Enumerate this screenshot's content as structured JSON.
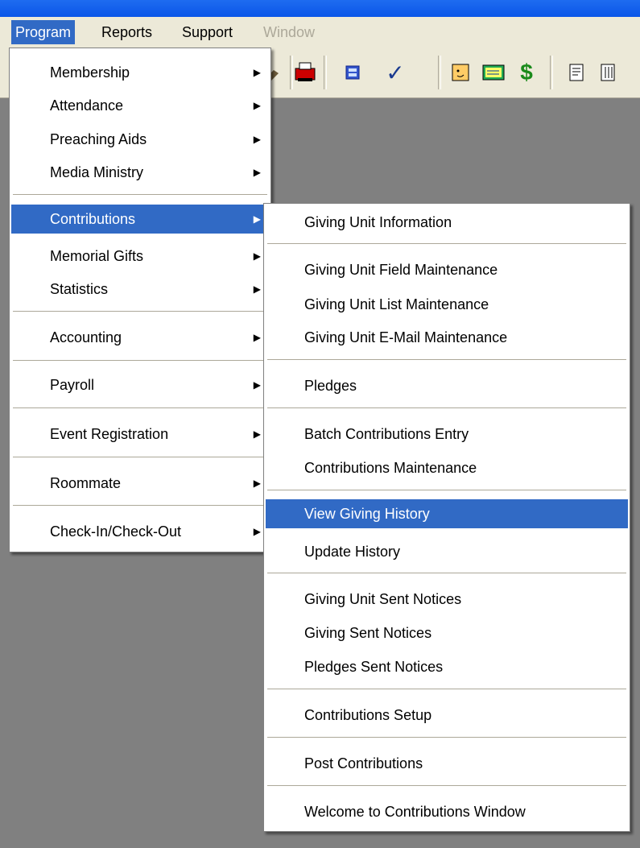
{
  "menubar": {
    "items": [
      {
        "label": "Program",
        "state": "active"
      },
      {
        "label": "Reports",
        "state": "normal"
      },
      {
        "label": "Support",
        "state": "normal"
      },
      {
        "label": "Window",
        "state": "disabled"
      }
    ]
  },
  "program_menu": {
    "items": [
      {
        "label": "Membership",
        "submenu": true
      },
      {
        "label": "Attendance",
        "submenu": true
      },
      {
        "label": "Preaching Aids",
        "submenu": true
      },
      {
        "label": "Media Ministry",
        "submenu": true
      },
      {
        "label": "Contributions",
        "submenu": true,
        "highlighted": true
      },
      {
        "label": "Memorial Gifts",
        "submenu": true
      },
      {
        "label": "Statistics",
        "submenu": true
      },
      {
        "label": "Accounting",
        "submenu": true
      },
      {
        "label": "Payroll",
        "submenu": true
      },
      {
        "label": "Event Registration",
        "submenu": true
      },
      {
        "label": "Roommate",
        "submenu": true
      },
      {
        "label": "Check-In/Check-Out",
        "submenu": true
      }
    ]
  },
  "contributions_menu": {
    "items": [
      {
        "label": "Giving Unit Information"
      },
      {
        "label": "Giving Unit Field Maintenance"
      },
      {
        "label": "Giving Unit List Maintenance"
      },
      {
        "label": "Giving Unit E-Mail Maintenance"
      },
      {
        "label": "Pledges"
      },
      {
        "label": "Batch Contributions Entry"
      },
      {
        "label": "Contributions Maintenance"
      },
      {
        "label": "View Giving History",
        "highlighted": true
      },
      {
        "label": "Update History"
      },
      {
        "label": "Giving Unit Sent Notices"
      },
      {
        "label": "Giving Sent Notices"
      },
      {
        "label": "Pledges Sent Notices"
      },
      {
        "label": "Contributions Setup"
      },
      {
        "label": "Post Contributions"
      },
      {
        "label": "Welcome to Contributions Window"
      }
    ]
  },
  "toolbar": {
    "icons": [
      "tool-icon",
      "printer-icon",
      "calculator-icon",
      "checkmark-icon",
      "calendar-face-icon",
      "notes-icon",
      "dollar-icon",
      "report-list-icon",
      "report-columns-icon"
    ],
    "dollar_glyph": "$",
    "check_glyph": "✓"
  },
  "colors": {
    "highlight": "#316ac5",
    "menu_bg": "#ffffff",
    "workspace": "#808080",
    "chrome": "#ece9d8"
  }
}
